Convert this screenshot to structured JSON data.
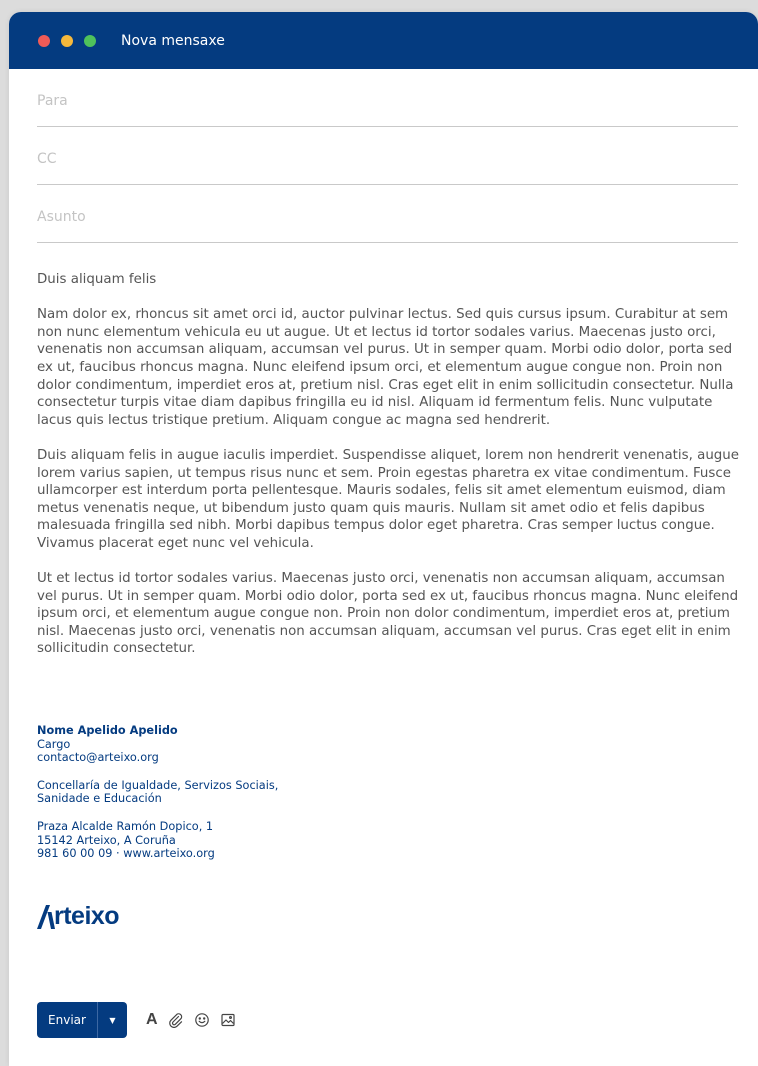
{
  "window": {
    "title": "Nova mensaxe"
  },
  "fields": {
    "to_placeholder": "Para",
    "cc_placeholder": "CC",
    "subject_placeholder": "Asunto"
  },
  "message": {
    "greeting": "Duis aliquam felis",
    "paragraphs": [
      "Nam dolor ex, rhoncus sit amet orci id, auctor pulvinar lectus. Sed quis cursus ipsum. Curabitur at sem non nunc elementum vehicula eu ut augue. Ut et lectus id tortor sodales varius. Maecenas justo orci, venenatis non accumsan aliquam, accumsan vel purus. Ut in semper quam. Morbi odio dolor, porta sed ex ut, faucibus rhoncus magna. Nunc eleifend ipsum orci, et elementum augue congue non. Proin non dolor condimentum, imperdiet eros at, pretium nisl. Cras eget elit in enim sollicitudin consectetur. Nulla consectetur turpis vitae diam dapibus fringilla eu id nisl. Aliquam id fermentum felis. Nunc vulputate lacus quis lectus tristique pretium. Aliquam congue ac magna sed hendrerit.",
      "Duis aliquam felis in augue iaculis imperdiet. Suspendisse aliquet, lorem non hendrerit venenatis, augue lorem varius sapien, ut tempus risus nunc et sem. Proin egestas pharetra ex vitae condimentum. Fusce ullamcorper est interdum porta pellentesque. Mauris sodales, felis sit amet elementum euismod, diam metus venenatis neque, ut bibendum justo quam quis mauris. Nullam sit amet odio et felis dapibus malesuada fringilla sed nibh. Morbi dapibus tempus dolor eget pharetra. Cras semper luctus congue. Vivamus placerat eget nunc vel vehicula.",
      "Ut et lectus id tortor sodales varius. Maecenas justo orci, venenatis non accumsan aliquam, accumsan vel purus. Ut in semper quam. Morbi odio dolor, porta sed ex ut, faucibus rhoncus magna. Nunc eleifend ipsum orci, et elementum augue congue non. Proin non dolor condimentum, imperdiet eros at, pretium nisl. Maecenas justo orci, venenatis non accumsan aliquam, accumsan vel purus. Cras eget elit in enim sollicitudin consectetur."
    ]
  },
  "signature": {
    "name": "Nome Apelido Apelido",
    "role": "Cargo",
    "email": "contacto@arteixo.org",
    "department_line1": "Concellaría de Igualdade, Servizos Sociais,",
    "department_line2": "Sanidade e Educación",
    "address_line1": "Praza Alcalde Ramón Dopico, 1",
    "address_line2": "15142 Arteixo, A Coruña",
    "contact_line": "981 60 00 09 · www.arteixo.org",
    "logo_text": "rteixo"
  },
  "toolbar": {
    "send_label": "Enviar",
    "send_menu_glyph": "▼",
    "font_glyph": "A"
  },
  "colors": {
    "brand": "#043b80",
    "close": "#ef5b57",
    "minimize": "#f6b93c",
    "maximize": "#4fc25b"
  },
  "icons": [
    "font-format-icon",
    "attachment-icon",
    "emoji-icon",
    "image-icon",
    "chevron-down-icon"
  ]
}
